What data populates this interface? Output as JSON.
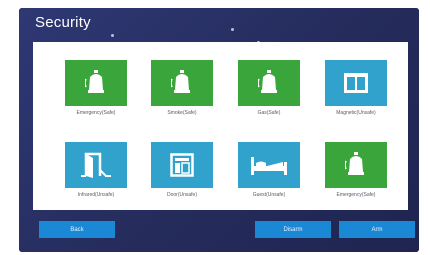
{
  "header": {
    "title": "Security"
  },
  "zones": [
    {
      "label": "Emergency(Safe)",
      "icon": "alarm-bell-icon",
      "state": "safe",
      "color": "#3aa53a"
    },
    {
      "label": "Smoke(Safe)",
      "icon": "alarm-bell-icon",
      "state": "safe",
      "color": "#3aa53a"
    },
    {
      "label": "Gas(Safe)",
      "icon": "alarm-bell-icon",
      "state": "safe",
      "color": "#3aa53a"
    },
    {
      "label": "Magnetic(Unsafe)",
      "icon": "window-sensor-icon",
      "state": "unsafe",
      "color": "#30a2cb"
    },
    {
      "label": "Infrared(Unsafe)",
      "icon": "door-icon",
      "state": "unsafe",
      "color": "#30a2cb"
    },
    {
      "label": "Door(Unsafe)",
      "icon": "window-icon",
      "state": "unsafe",
      "color": "#30a2cb"
    },
    {
      "label": "Guest(Unsafe)",
      "icon": "bed-icon",
      "state": "unsafe",
      "color": "#30a2cb"
    },
    {
      "label": "Emergency(Safe)",
      "icon": "alarm-bell-icon",
      "state": "safe",
      "color": "#3aa53a"
    }
  ],
  "buttons": {
    "back": "Back",
    "disarm": "Disarm",
    "arm": "Arm"
  },
  "colors": {
    "background": "#272f61",
    "button": "#1b88d6",
    "safe": "#3aa53a",
    "unsafe": "#30a2cb"
  }
}
